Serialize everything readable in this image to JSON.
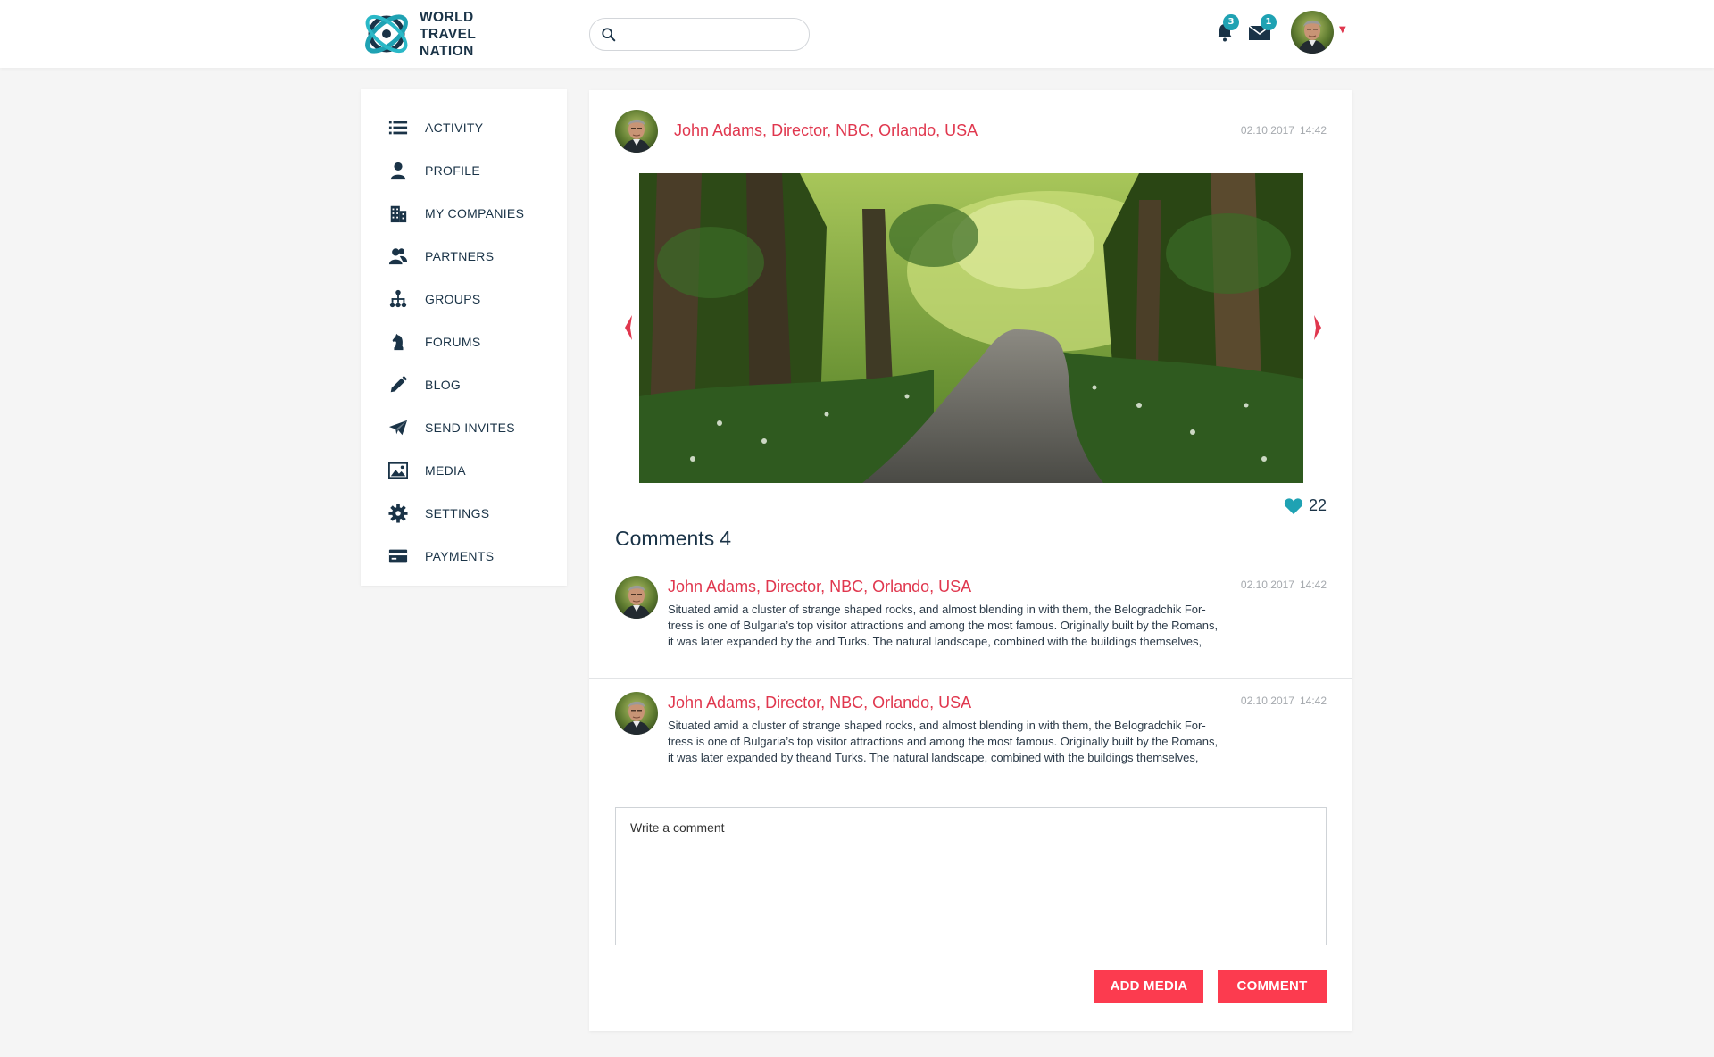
{
  "brand": {
    "name_line1": "WORLD",
    "name_line2": "TRAVEL",
    "name_line3": "NATION",
    "logo_icon": "globe-orbit-logo",
    "colors": {
      "primary_dark": "#1a3347",
      "accent_red": "#fc3b4f",
      "author_red": "#e0374e",
      "teal": "#1fa2b3"
    }
  },
  "header": {
    "search": {
      "placeholder": "",
      "value": "",
      "icon": "search-icon"
    },
    "notifications": {
      "icon": "bell-icon",
      "count": "3"
    },
    "messages": {
      "icon": "envelope-icon",
      "count": "1"
    },
    "user_menu": {
      "avatar": "user-avatar",
      "caret_icon": "caret-down-icon"
    }
  },
  "sidebar": {
    "items": [
      {
        "label": "ACTIVITY",
        "icon": "list-icon"
      },
      {
        "label": "PROFILE",
        "icon": "person-icon"
      },
      {
        "label": "MY COMPANIES",
        "icon": "building-icon"
      },
      {
        "label": "PARTNERS",
        "icon": "people-icon"
      },
      {
        "label": "GROUPS",
        "icon": "hierarchy-icon"
      },
      {
        "label": "FORUMS",
        "icon": "chess-knight-icon"
      },
      {
        "label": "BLOG",
        "icon": "pencil-icon"
      },
      {
        "label": "SEND INVITES",
        "icon": "paper-plane-icon"
      },
      {
        "label": "MEDIA",
        "icon": "image-icon"
      },
      {
        "label": "SETTINGS",
        "icon": "gear-icon"
      },
      {
        "label": "PAYMENTS",
        "icon": "credit-card-icon"
      }
    ]
  },
  "post": {
    "author": "John Adams, Director, NBC, Orlando, USA",
    "date": "02.10.2017",
    "time": "14:42",
    "image_alt": "forest road",
    "likes": "22",
    "comments_label": "Comments",
    "comments_count": "4"
  },
  "comments": [
    {
      "author": "John Adams, Director, NBC, Orlando, USA",
      "date": "02.10.2017",
      "time": "14:42",
      "line1": "Situated amid a cluster of strange shaped rocks, and almost blending in with them, the Belogradchik For-",
      "line2": "tress is one of Bulgaria’s top visitor attractions and among the most famous. Originally built by the Romans,",
      "line3": "it was later expanded by the and Turks. The natural landscape, combined with the buildings themselves,"
    },
    {
      "author": "John Adams, Director, NBC, Orlando, USA",
      "date": "02.10.2017",
      "time": "14:42",
      "line1": "Situated amid a cluster of strange shaped rocks, and almost blending in with them, the Belogradchik For-",
      "line2": "tress is one of Bulgaria’s top visitor attractions and among the most famous. Originally built by the Romans,",
      "line3": "it was later expanded by theand Turks. The natural landscape, combined with the buildings themselves,"
    }
  ],
  "composer": {
    "placeholder": "Write a comment",
    "add_media_label": "ADD MEDIA",
    "comment_label": "COMMENT"
  }
}
